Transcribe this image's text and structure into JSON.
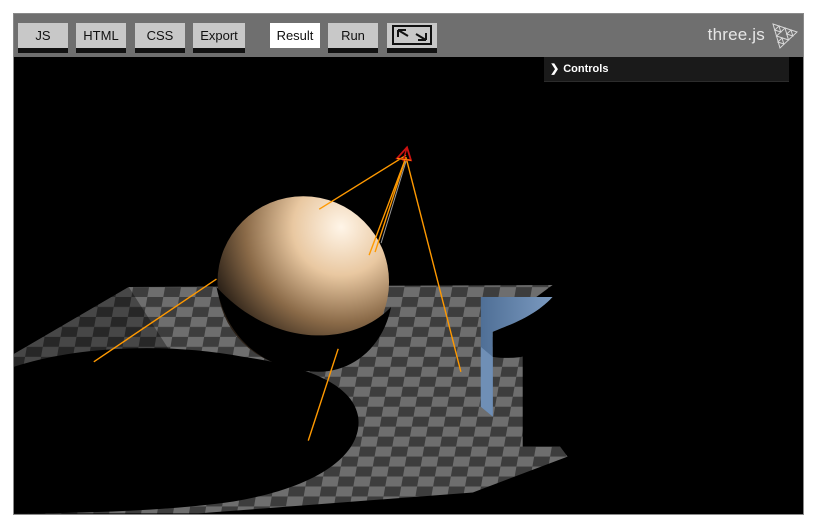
{
  "toolbar": {
    "buttons": {
      "js": "JS",
      "html": "HTML",
      "css": "CSS",
      "export": "Export",
      "result": "Result",
      "run": "Run"
    },
    "fullscreen_icon": "expand-arrows-icon",
    "logo_text": "three.js",
    "logo_icon": "three-js-logo-icon",
    "active_tab": "Result"
  },
  "controls": {
    "label": "Controls",
    "chevron_icon": "chevron-right-icon"
  },
  "colors": {
    "toolbar_bg": "#6f6f6f",
    "button_bg": "#c8c8c8",
    "active_button_bg": "#ffffff",
    "viewport_bg": "#000000",
    "helper_lines": "#ff9900",
    "light_marker": "#cc1111",
    "box": "#5e7fa8"
  }
}
